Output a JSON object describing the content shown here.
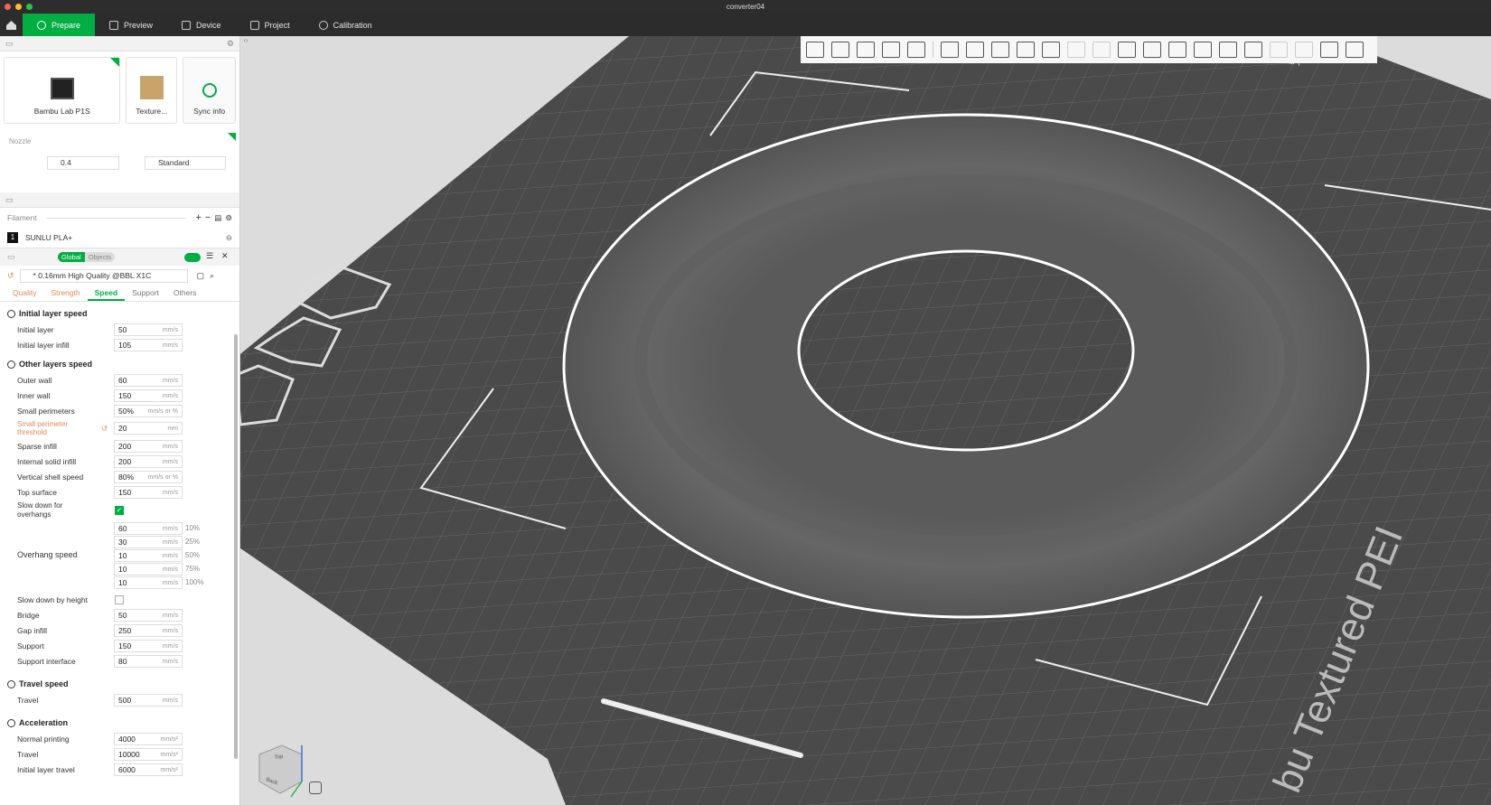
{
  "window": {
    "title": "converter04"
  },
  "nav": {
    "tabs": [
      {
        "label": "Prepare"
      },
      {
        "label": "Preview"
      },
      {
        "label": "Device"
      },
      {
        "label": "Project"
      },
      {
        "label": "Calibration"
      }
    ]
  },
  "printer": {
    "printer_name": "Bambu Lab P1S",
    "plate_name": "Texture...",
    "sync_label": "Sync info"
  },
  "nozzle": {
    "label": "Nozzle",
    "diameter": "0.4",
    "flow": "Standard"
  },
  "filament": {
    "header": "Filament",
    "items": [
      {
        "index": "1",
        "name": "SUNLU PLA+"
      }
    ]
  },
  "process": {
    "toggle_global": "Global",
    "toggle_objects": "Objects",
    "preset": "* 0.16mm High Quality @BBL X1C",
    "tabs": [
      {
        "label": "Quality"
      },
      {
        "label": "Strength"
      },
      {
        "label": "Speed"
      },
      {
        "label": "Support"
      },
      {
        "label": "Others"
      }
    ]
  },
  "speed": {
    "initial_header": "Initial layer speed",
    "initial_rows": [
      {
        "label": "Initial layer",
        "value": "50",
        "unit": "mm/s"
      },
      {
        "label": "Initial layer infill",
        "value": "105",
        "unit": "mm/s"
      }
    ],
    "other_header": "Other layers speed",
    "other_rows": [
      {
        "label": "Outer wall",
        "value": "60",
        "unit": "mm/s"
      },
      {
        "label": "Inner wall",
        "value": "150",
        "unit": "mm/s"
      },
      {
        "label": "Small perimeters",
        "value": "50%",
        "unit": "mm/s or %"
      }
    ],
    "threshold": {
      "label_line1": "Small perimeter",
      "label_line2": "threshold",
      "value": "20",
      "unit": "mm"
    },
    "other_rows2": [
      {
        "label": "Sparse infill",
        "value": "200",
        "unit": "mm/s"
      },
      {
        "label": "Internal solid infill",
        "value": "200",
        "unit": "mm/s"
      },
      {
        "label": "Vertical shell speed",
        "value": "80%",
        "unit": "mm/s or %"
      },
      {
        "label": "Top surface",
        "value": "150",
        "unit": "mm/s"
      }
    ],
    "slow_overhang": {
      "line1": "Slow down for",
      "line2": "overhangs"
    },
    "overhang_label": "Overhang speed",
    "overhang_rows": [
      {
        "value": "60",
        "unit": "mm/s",
        "pct": "10%"
      },
      {
        "value": "30",
        "unit": "mm/s",
        "pct": "25%"
      },
      {
        "value": "10",
        "unit": "mm/s",
        "pct": "50%"
      },
      {
        "value": "10",
        "unit": "mm/s",
        "pct": "75%"
      },
      {
        "value": "10",
        "unit": "mm/s",
        "pct": "100%"
      }
    ],
    "slow_height": "Slow down by height",
    "other_rows3": [
      {
        "label": "Bridge",
        "value": "50",
        "unit": "mm/s"
      },
      {
        "label": "Gap infill",
        "value": "250",
        "unit": "mm/s"
      },
      {
        "label": "Support",
        "value": "150",
        "unit": "mm/s"
      },
      {
        "label": "Support interface",
        "value": "80",
        "unit": "mm/s"
      }
    ],
    "travel_header": "Travel speed",
    "travel_rows": [
      {
        "label": "Travel",
        "value": "500",
        "unit": "mm/s"
      }
    ],
    "accel_header": "Acceleration",
    "accel_rows": [
      {
        "label": "Normal printing",
        "value": "4000",
        "unit": "mm/s²"
      },
      {
        "label": "Travel",
        "value": "10000",
        "unit": "mm/s²"
      },
      {
        "label": "Initial layer travel",
        "value": "6000",
        "unit": "mm/s²"
      }
    ]
  },
  "viewport": {
    "plate_text": "bu Textured PEI",
    "plate_top_text": "PLA",
    "cube_top": "Top",
    "cube_back": "Back"
  },
  "colors": {
    "accent": "#00ae42",
    "plate": "#4a4a4a",
    "modified": "#e08b5a"
  }
}
